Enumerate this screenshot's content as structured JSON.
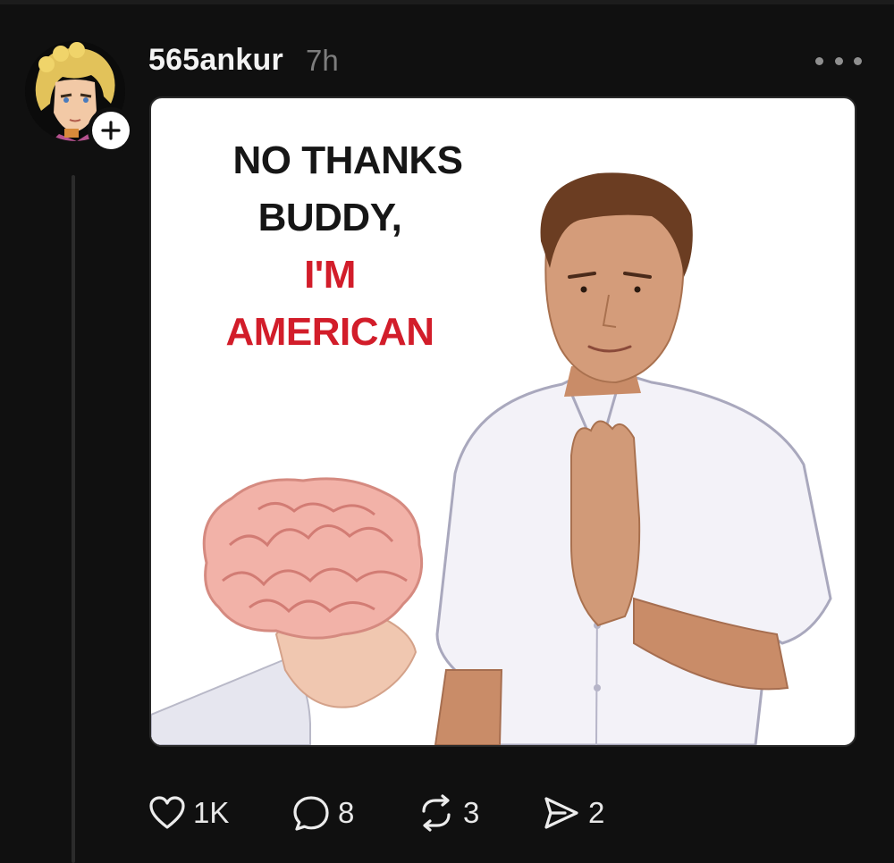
{
  "post": {
    "username": "565ankur",
    "timestamp": "7h",
    "avatar_icon": "anime-character-avatar",
    "image": {
      "caption_lines": [
        "NO THANKS",
        "BUDDY,",
        "I'M",
        "AMERICAN"
      ],
      "caption_colors": [
        "#161616",
        "#161616",
        "#d21d2a",
        "#d21d2a"
      ],
      "illustration": "man-refusing-offered-brain"
    }
  },
  "actions": {
    "like": {
      "icon": "heart-icon",
      "count": "1K"
    },
    "comment": {
      "icon": "comment-icon",
      "count": "8"
    },
    "repost": {
      "icon": "repost-icon",
      "count": "3"
    },
    "share": {
      "icon": "send-icon",
      "count": "2"
    }
  },
  "colors": {
    "background": "#101010",
    "text": "#f3f3f3",
    "muted": "#7d7d7d",
    "accent_red": "#d21d2a"
  }
}
